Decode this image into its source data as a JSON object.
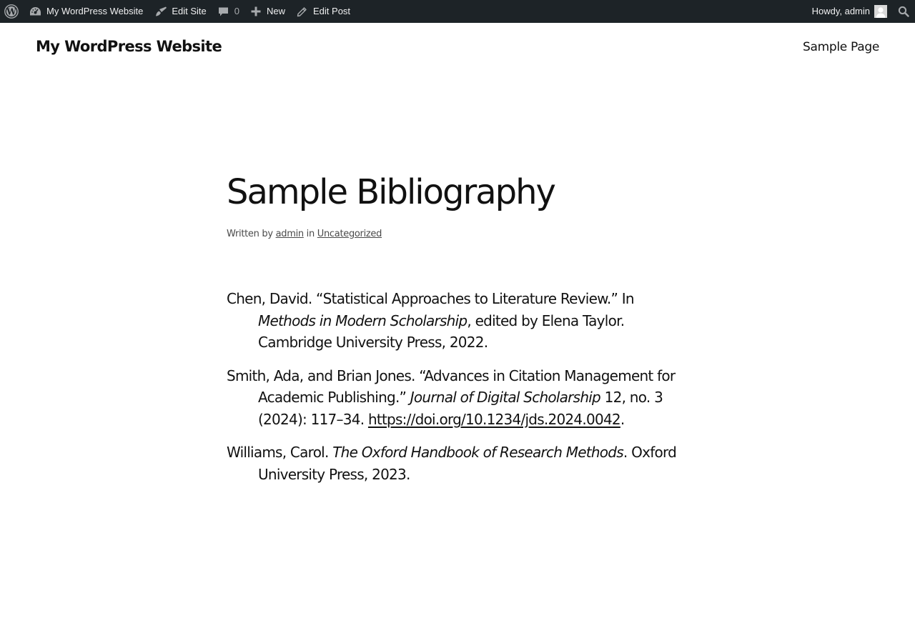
{
  "adminbar": {
    "site_name": "My WordPress Website",
    "edit_site": "Edit Site",
    "comments_count": "0",
    "new": "New",
    "edit_post": "Edit Post",
    "howdy": "Howdy, admin",
    "icons": {
      "wp": "wordpress-logo-icon",
      "site": "dashboard-icon",
      "edit_site": "paintbrush-icon",
      "comments": "comment-bubble-icon",
      "new": "plus-icon",
      "edit_post": "pencil-icon",
      "avatar": "avatar-icon",
      "search": "search-icon"
    },
    "colors": {
      "background": "#1d2327",
      "text": "#f0f0f1",
      "muted": "#a7aaad"
    }
  },
  "header": {
    "site_title": "My WordPress Website",
    "nav": [
      "Sample Page"
    ]
  },
  "post": {
    "title": "Sample Bibliography",
    "meta": {
      "written_by": "Written by",
      "author": "admin",
      "in": "in",
      "category": "Uncategorized"
    },
    "entries": [
      {
        "a": "Chen, David. “Statistical Approaches to Literature Review.” In ",
        "b": "Methods in Modern Scholarship",
        "c": ", edited by Elena Taylor. Cambridge University Press, 2022."
      },
      {
        "a": "Smith, Ada, and Brian Jones. “Advances in Citation Management for Academic Publishing.” ",
        "b": "Journal of Digital Scholarship",
        "c": " 12, no. 3 (2024): 117–34. ",
        "link": "https://doi.org/10.1234/jds.2024.0042",
        "d": "."
      },
      {
        "a": "Williams, Carol. ",
        "b": "The Oxford Handbook of Research Methods",
        "c": ". Oxford University Press, 2023."
      }
    ]
  }
}
